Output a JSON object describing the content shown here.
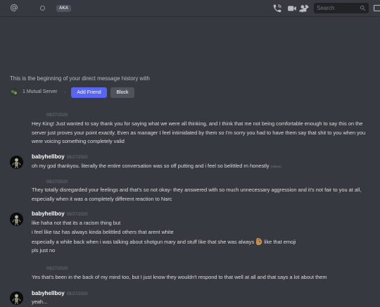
{
  "header": {
    "status_badge": "AKA",
    "search_placeholder": "Search"
  },
  "intro": {
    "welcome": "This is the beginning of your direct message history with",
    "mutual_servers": "1 Mutual Server",
    "add_friend_label": "Add Friend",
    "block_label": "Block"
  },
  "messages": [
    {
      "timestamp": "09/27/2020",
      "text": "Hey King! Just wanted to say thank you for saying what we were all thinking, and I think that me not being comfortable enough to say this on the server just proves your point exactly. Even as manager    I feel intimidated by them so I'm sorry you had to have them say that shit to you when you were voicing something completely valid"
    },
    {
      "author": "babyhellboy",
      "timestamp": "09/27/2020",
      "lines": [
        "oh my god thankyou. literally the entire conversation was so off putting and i feel so belittled rn honestly"
      ],
      "edited": "(edited)"
    },
    {
      "timestamp": "09/27/2020",
      "text": "They totally disregarded your feelings and that's so not okay- they answered with so much unnecessary aggression and it's not fair to you at all, especially when it was a completely different reaction to Narc"
    },
    {
      "author": "babyhellboy",
      "timestamp": "09/27/2020",
      "lines": [
        "like haha not that its a racism thing but",
        "i feel like taz has always kinda belittled others that arent white",
        "especially a while back when i was talking about shotgun mary and stuff like that she was always",
        "like that emoji",
        "pls just no"
      ]
    },
    {
      "timestamp": "09/27/2020",
      "text": "Yes that's been in the back of my mind too, but I just know they wouldn't respond to that well at all and that says a lot about them"
    },
    {
      "author": "babyhellboy",
      "timestamp": "09/27/2020",
      "lines": [
        "yeah..."
      ]
    }
  ],
  "colors": {
    "background": "#36393f",
    "blurple": "#5865f2",
    "text": "#dcddde",
    "muted": "#72767d"
  },
  "icons": [
    "at-icon",
    "status-icon",
    "phone-call-icon",
    "video-call-icon",
    "pin-icon",
    "add-user-icon",
    "search-icon",
    "inbox-icon"
  ]
}
